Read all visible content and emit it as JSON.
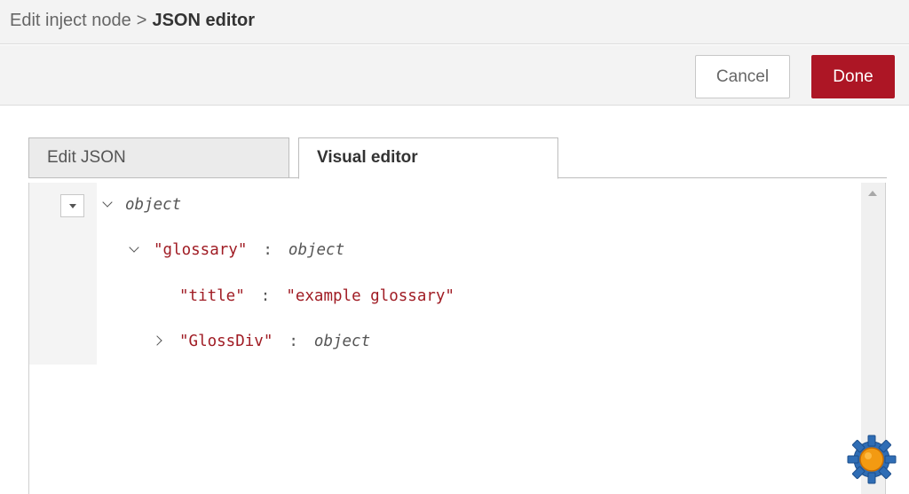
{
  "breadcrumb": {
    "parent": "Edit inject node",
    "separator": ">",
    "current": "JSON editor"
  },
  "toolbar": {
    "cancel_label": "Cancel",
    "done_label": "Done"
  },
  "tabs": [
    {
      "label": "Edit JSON",
      "active": false
    },
    {
      "label": "Visual editor",
      "active": true
    }
  ],
  "tree": {
    "root_type": "object",
    "glossary": {
      "key": "\"glossary\"",
      "colon": ":",
      "type": "object"
    },
    "title": {
      "key": "\"title\"",
      "colon": ":",
      "value": "\"example glossary\""
    },
    "glossdiv": {
      "key": "\"GlossDiv\"",
      "colon": ":",
      "type": "object"
    }
  },
  "colors": {
    "done_button": "#ad1625",
    "key_text": "#a01c24",
    "header_bg": "#f3f3f3"
  },
  "icons": [
    "chevron-down-icon",
    "chevron-right-icon",
    "collapse-all-icon",
    "scroll-up-icon",
    "gear-icon"
  ]
}
